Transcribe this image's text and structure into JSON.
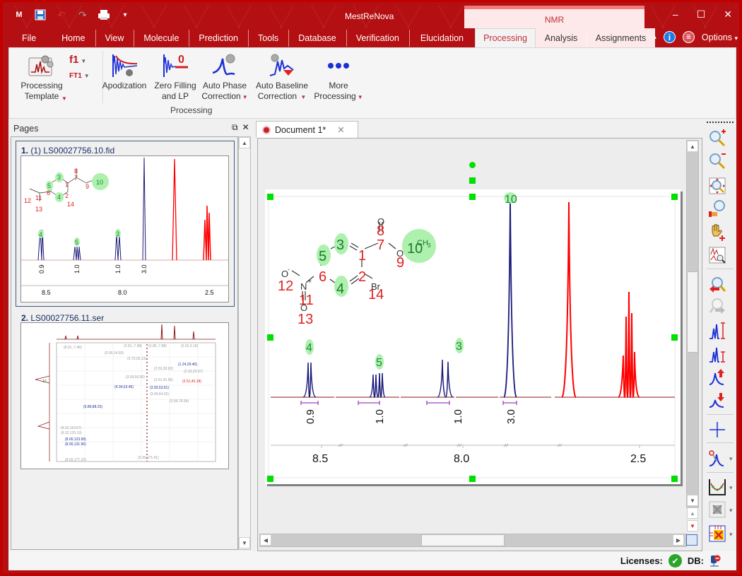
{
  "app": {
    "title": "MestReNova",
    "context_group": "NMR",
    "window_controls": [
      "minimize",
      "maximize",
      "close"
    ]
  },
  "quick_access": [
    "mnova-logo-icon",
    "save-icon",
    "undo-icon",
    "redo-icon",
    "print-icon",
    "customize-qat-icon"
  ],
  "menu": {
    "tabs": [
      {
        "label": "File"
      },
      {
        "label": "Home"
      },
      {
        "label": "View"
      },
      {
        "label": "Molecule"
      },
      {
        "label": "Prediction"
      },
      {
        "label": "Tools"
      },
      {
        "label": "Database"
      },
      {
        "label": "Verification"
      },
      {
        "label": "Elucidation"
      },
      {
        "label": "Processing",
        "active": true,
        "context": true
      },
      {
        "label": "Analysis",
        "context": true
      },
      {
        "label": "Assignments",
        "context": true
      }
    ],
    "options_label": "Options"
  },
  "ribbon": {
    "buttons": {
      "processing_template": "Processing Template",
      "f1": "f1",
      "ft1": "FT1",
      "apodization": "Apodization",
      "zero_filling_1": "Zero Filling",
      "zero_filling_2": "and LP",
      "auto_phase_1": "Auto Phase",
      "auto_phase_2": "Correction",
      "auto_baseline_1": "Auto Baseline",
      "auto_baseline_2": "Correction",
      "more_1": "More",
      "more_2": "Processing"
    },
    "group_label": "Processing"
  },
  "pages_panel": {
    "title": "Pages",
    "pages": [
      {
        "number": "1.",
        "label": "(1) LS00027756.10.fid",
        "selected": true
      },
      {
        "number": "2.",
        "label": "LS00027756.11.ser",
        "selected": false
      }
    ],
    "thumb1_axis": [
      "8.5",
      "8.0",
      "2.5"
    ],
    "thumb1_integrals": [
      "0.9",
      "1.0",
      "1.0",
      "3.0"
    ],
    "thumb2_annotations": [
      "(8.01,-7.46)",
      "(5.00,14.93)",
      "(3.91,-7.98)",
      "(3.90,-7.98)",
      "(2.52,3.19)",
      "(3.70,26.13)",
      "(1.24,29.40)",
      "(2.53,39.62)",
      "(2.33,29.37)",
      "(3.93,50.50)",
      "(2.51,41.96)",
      "(2.51,40.18)",
      "(4.34,53.45)",
      "(3.93,53.61)",
      "(3.94,64.02)",
      "(5.86,88.23)",
      "(3.06,78.04)",
      "(8.32,116.67)",
      "(8.32,125.19)",
      "(8.00,123.58)",
      "(8.00,131.96)",
      "(8.02,177.10)",
      "(3.30,171.41)"
    ]
  },
  "document": {
    "tab_label": "Document 1*",
    "molecule": {
      "atoms": [
        {
          "id": "1",
          "color": "red"
        },
        {
          "id": "2",
          "color": "red"
        },
        {
          "id": "3",
          "color": "green",
          "highlight": true
        },
        {
          "id": "4",
          "color": "green",
          "highlight": true
        },
        {
          "id": "5",
          "color": "green",
          "highlight": true
        },
        {
          "id": "6",
          "color": "red"
        },
        {
          "id": "7",
          "color": "red"
        },
        {
          "id": "8",
          "color": "red"
        },
        {
          "id": "9",
          "color": "red"
        },
        {
          "id": "10",
          "color": "green",
          "highlight": true
        },
        {
          "id": "11",
          "color": "red"
        },
        {
          "id": "12",
          "color": "red"
        },
        {
          "id": "13",
          "color": "red"
        },
        {
          "id": "14",
          "color": "red"
        }
      ],
      "element_labels": {
        "o_top": "O",
        "o_ester": "O",
        "ch3": "CH3",
        "br": "Br",
        "n": "N",
        "n_charge": "+",
        "o_minus": "O",
        "o_minus_charge": "-",
        "o_nitro": "O"
      }
    },
    "spectrum": {
      "x_ticks": [
        "8.5",
        "8.0",
        "2.5"
      ],
      "peak_labels": [
        "4",
        "5",
        "3",
        "10"
      ],
      "integrals": [
        "0.9",
        "1.0",
        "1.0",
        "3.0"
      ],
      "colors": {
        "assigned": "#1a1a7a",
        "unassigned": "#ff0000",
        "integral": "#a040c0",
        "label_bg": "#a8f0a8",
        "label_text": "#1b8a3a"
      }
    }
  },
  "side_toolbar": [
    "zoom-in-icon",
    "zoom-out-icon",
    "full-view-icon",
    "manual-zoom-icon",
    "pan-icon",
    "fit-spectrum-icon",
    "previous-zoom-icon",
    "next-zoom-icon",
    "increase-intensity-icon",
    "decrease-intensity-icon",
    "raise-spectrum-icon",
    "lower-spectrum-icon",
    "crosshair-icon",
    "cut-icon",
    "baseline-icon",
    "2d-view-icon",
    "stacked-icon"
  ],
  "status": {
    "licenses_label": "Licenses:",
    "db_label": "DB:"
  }
}
